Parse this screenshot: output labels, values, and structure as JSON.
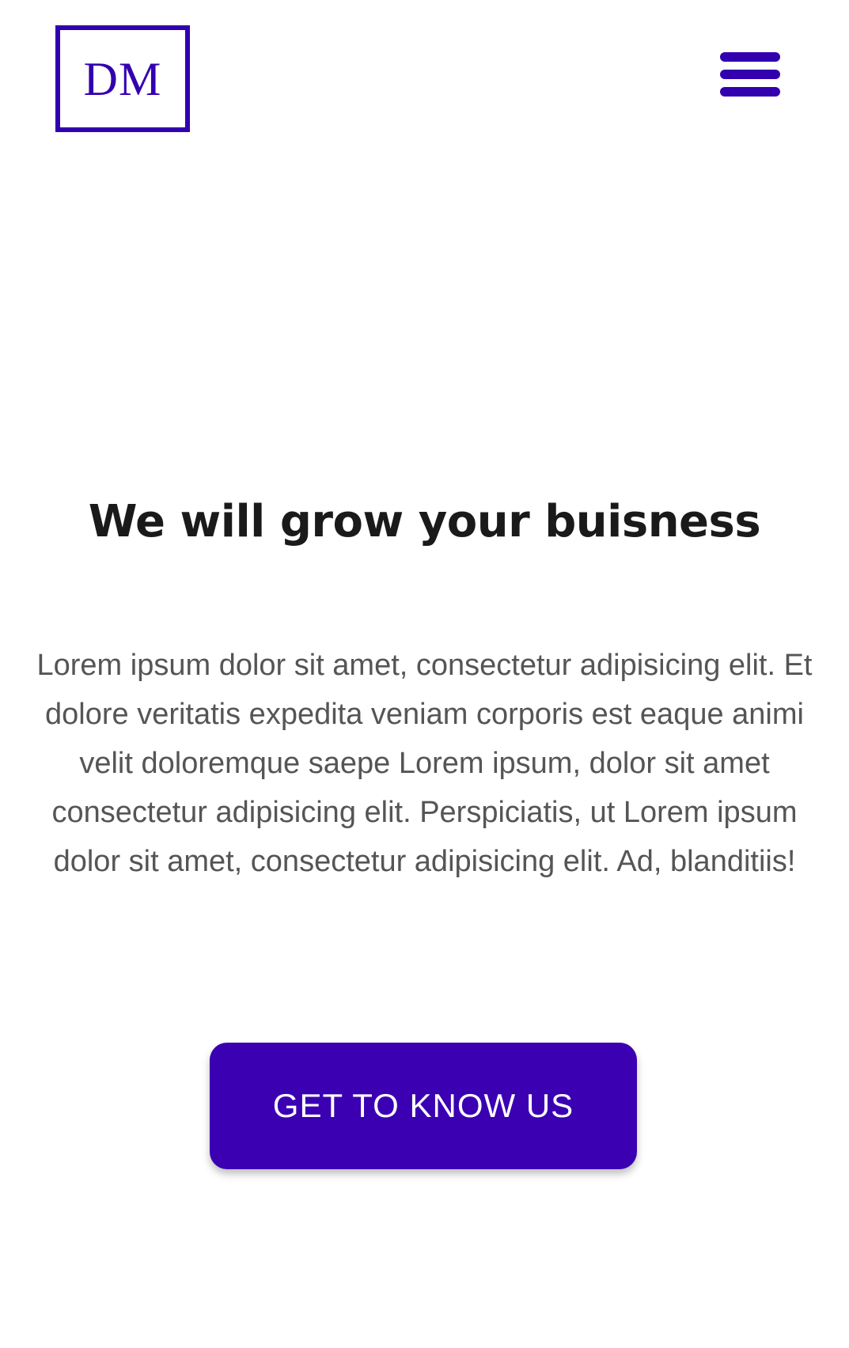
{
  "header": {
    "logo_text": "DM",
    "menu_icon": "hamburger-menu-icon"
  },
  "hero": {
    "title": "We will grow your buisness",
    "description": "Lorem ipsum dolor sit amet, consectetur adipisicing elit. Et dolore veritatis expedita veniam corporis est eaque animi velit doloremque saepe Lorem ipsum, dolor sit amet consectetur adipisicing elit. Perspiciatis, ut Lorem ipsum dolor sit amet, consectetur adipisicing elit. Ad, blanditiis!",
    "cta_label": "GET TO KNOW US"
  },
  "colors": {
    "accent": "#3300b0",
    "cta_background": "#3a00b2",
    "heading": "#1a1a1a",
    "body_text": "#555555",
    "background": "#ffffff"
  }
}
